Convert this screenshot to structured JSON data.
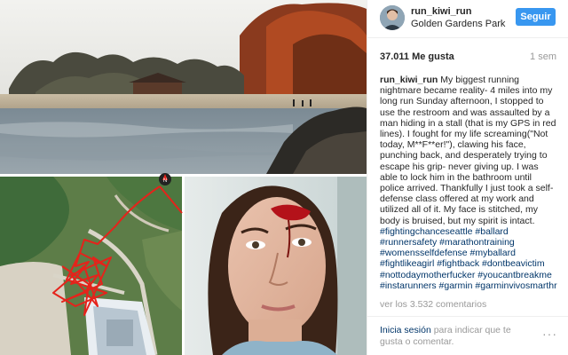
{
  "post": {
    "username": "run_kiwi_run",
    "location": "Golden Gardens Park",
    "follow_label": "Seguir",
    "likes": "37.011 Me gusta",
    "time": "1 sem",
    "caption_user": "run_kiwi_run",
    "caption_text": "My biggest running nightmare became reality- 4 miles into my long run Sunday afternoon, I stopped to use the restroom and was assaulted by a man hiding in a stall (that is my GPS in red lines). I fought for my life screaming(\"Not today, M**F**er!\"), clawing his face, punching back, and desperately trying to escape his grip- never giving up. I was able to lock him in the bathroom until police arrived. Thankfully I just took a self-defense class offered at my work and utilized all of it. My face is stitched, my body is bruised, but my spirit is intact.",
    "hashtags": "#fightingchanceseattle #ballard #runnersafety #marathontraining #womensselfdefense #myballard #fightlikeagirl #fightback #dontbeavictim #nottodaymotherfucker #youcantbreakme #instarunners #garmin #garminvivosmarthr",
    "comments_label": "ver los 3.532 comentarios",
    "login_link": "Inicia sesión",
    "login_rest": " para indicar que te gusta o comentar.",
    "more_label": "···"
  },
  "colors": {
    "follow_button": "#3897f0",
    "hashtag": "#003569",
    "muted": "#999999",
    "gps_track": "#e5231b"
  },
  "icons": {
    "compass": "compass-icon",
    "more": "more-options-icon"
  }
}
